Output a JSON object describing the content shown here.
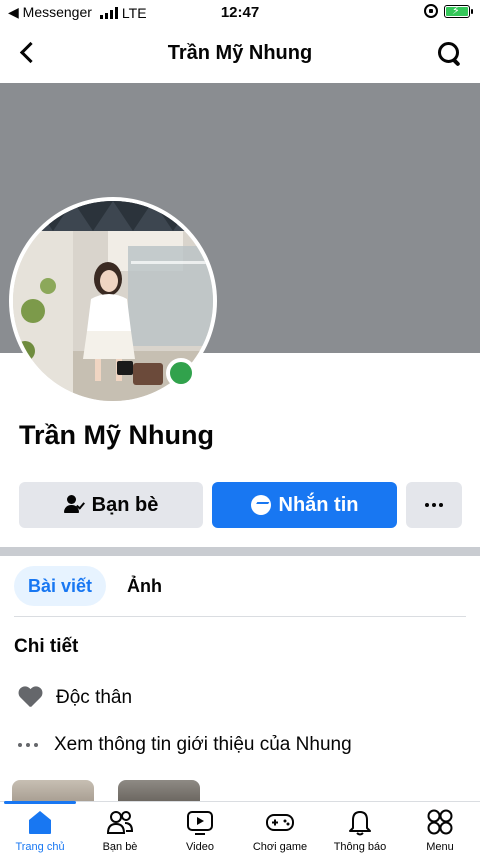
{
  "status_bar": {
    "back_app": "◀ Messenger",
    "network": "LTE",
    "time": "12:47"
  },
  "header": {
    "title": "Trần Mỹ Nhung"
  },
  "profile": {
    "name": "Trần Mỹ Nhung",
    "online": true
  },
  "actions": {
    "friends_label": "Bạn bè",
    "message_label": "Nhắn tin"
  },
  "tabs": [
    {
      "label": "Bài viết",
      "active": true
    },
    {
      "label": "Ảnh",
      "active": false
    }
  ],
  "details": {
    "title": "Chi tiết",
    "relationship": "Độc thân",
    "about_link": "Xem thông tin giới thiệu của Nhung"
  },
  "bottom_nav": [
    {
      "label": "Trang chủ",
      "icon": "home-icon",
      "active": true
    },
    {
      "label": "Bạn bè",
      "icon": "friends-icon",
      "active": false
    },
    {
      "label": "Video",
      "icon": "video-icon",
      "active": false
    },
    {
      "label": "Chơi game",
      "icon": "gaming-icon",
      "active": false
    },
    {
      "label": "Thông báo",
      "icon": "bell-icon",
      "active": false
    },
    {
      "label": "Menu",
      "icon": "menu-grid-icon",
      "active": false
    }
  ],
  "colors": {
    "accent": "#1877f2",
    "cover": "#8a8d91",
    "online": "#31a24c",
    "button_gray": "#e4e6eb"
  }
}
